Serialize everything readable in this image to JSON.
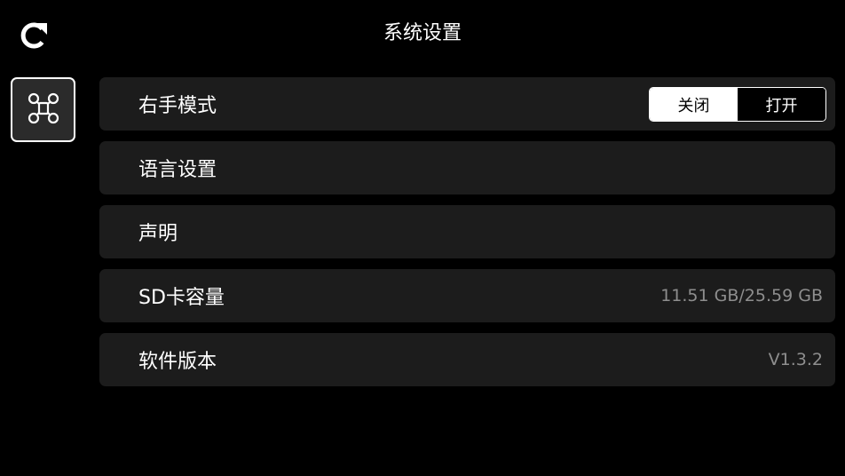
{
  "header": {
    "title": "系统设置",
    "back_icon": "refresh-arrow-icon"
  },
  "sidebar": {
    "tabs": [
      {
        "icon": "drone-icon",
        "selected": true
      }
    ]
  },
  "settings": {
    "right_hand_mode": {
      "label": "右手模式",
      "options": [
        "关闭",
        "打开"
      ],
      "selected": "关闭"
    },
    "language": {
      "label": "语言设置"
    },
    "statement": {
      "label": "声明"
    },
    "sd_capacity": {
      "label": "SD卡容量",
      "value": "11.51 GB/25.59 GB"
    },
    "software_version": {
      "label": "软件版本",
      "value": "V1.3.2"
    }
  },
  "colors": {
    "background": "#000000",
    "row_background": "#1c1c1c",
    "text": "#ffffff",
    "secondary_text": "#8e8e8e",
    "selected_segment": "#ffffff"
  }
}
